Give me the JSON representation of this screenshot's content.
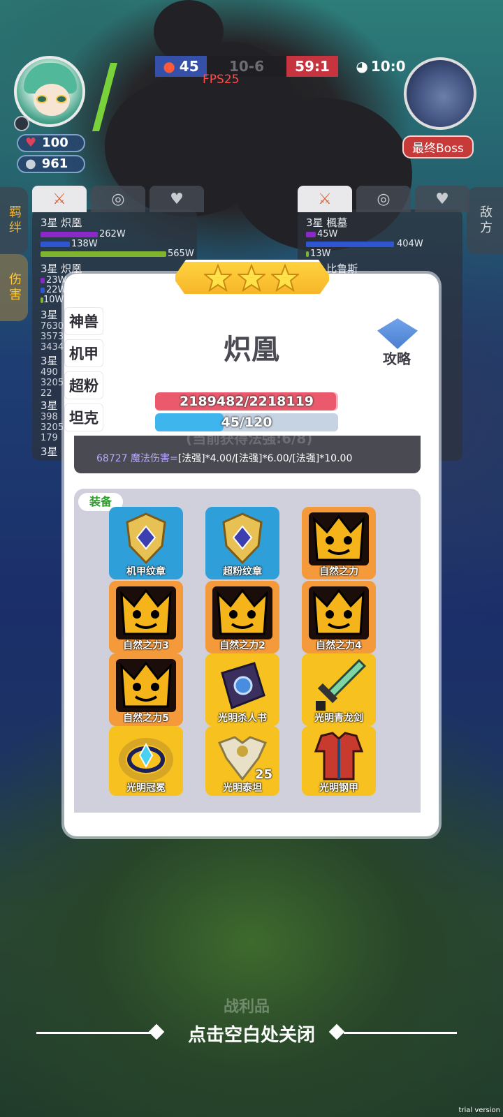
{
  "hud": {
    "player": {
      "hearts": "100",
      "coins": "961"
    },
    "score_left": "45",
    "score_mid": "10-6",
    "score_right": "59:1",
    "timer": "10:0",
    "fps": "FPS25",
    "boss_label": "最终Boss"
  },
  "side_tabs": {
    "left_bond": "羁绊",
    "left_damage": "伤害",
    "right_enemy": "敌方"
  },
  "stat_panel_left": {
    "rows": [
      {
        "name": "3星 炽凰",
        "val1": "262W",
        "val2": "138W",
        "val3": "565W"
      },
      {
        "name": "3星 炽凰",
        "val1": "23W",
        "val2": "22W",
        "val3": "10W"
      },
      {
        "name": "3星",
        "col": "7630\n3573\n3434"
      },
      {
        "name": "3星",
        "col": "490\n3205\n22"
      },
      {
        "name": "3星",
        "col": "398\n3205\n179"
      },
      {
        "name": "3星",
        "col": ""
      }
    ]
  },
  "stat_panel_right": {
    "rows": [
      {
        "name": "3星 楓墓",
        "val1": "45W",
        "val2": "404W",
        "val3": "13W"
      },
      {
        "name": "3星 比鲁斯",
        "val1": "",
        "val2": "",
        "val3": ""
      }
    ]
  },
  "modal": {
    "stars": 3,
    "hero_name": "炽凰",
    "guide_label": "攻略",
    "left_tabs": [
      "神兽",
      "机甲",
      "超粉",
      "坦克"
    ],
    "hp_text": "2189482/2218119",
    "hp_fraction": 0.987,
    "mp_text": "45/120",
    "mp_fraction": 0.375,
    "skill_cut_text": "(当前获得法强:6/8)",
    "skill_prefix": "68727 魔法伤害=",
    "skill_formula": "[法强]*4.00/[法强]*6.00/[法强]*10.00",
    "equip_tag": "装备",
    "items": [
      {
        "label": "机甲纹章",
        "color": "blue",
        "icon": "shield-emblem-icon",
        "count": ""
      },
      {
        "label": "超粉纹章",
        "color": "blue",
        "icon": "shield-emblem-icon",
        "count": ""
      },
      {
        "label": "自然之力",
        "color": "orange",
        "icon": "crown-face-icon",
        "count": ""
      },
      {
        "label": "自然之力3",
        "color": "orange",
        "icon": "crown-face-icon",
        "count": ""
      },
      {
        "label": "自然之力2",
        "color": "orange",
        "icon": "crown-face-icon",
        "count": ""
      },
      {
        "label": "自然之力4",
        "color": "orange",
        "icon": "crown-face-icon",
        "count": ""
      },
      {
        "label": "自然之力5",
        "color": "orange",
        "icon": "crown-face-icon",
        "count": ""
      },
      {
        "label": "光明杀人书",
        "color": "gold",
        "icon": "spellbook-icon",
        "count": ""
      },
      {
        "label": "光明青龙剑",
        "color": "gold",
        "icon": "sword-icon",
        "count": ""
      },
      {
        "label": "光明冠冕",
        "color": "gold",
        "icon": "crown-ring-icon",
        "count": ""
      },
      {
        "label": "光明泰坦",
        "color": "gold",
        "icon": "titan-armor-icon",
        "count": "25"
      },
      {
        "label": "光明钢甲",
        "color": "gold",
        "icon": "steel-armor-icon",
        "count": ""
      }
    ]
  },
  "close_hint": "点击空白处关闭",
  "background_label": "战利品",
  "watermark": "trial version",
  "colors": {
    "hp": "#ea5a6c",
    "mp": "#3fb5ee",
    "star": "#ffd23f",
    "equip_tag": "#2d9b2a"
  }
}
